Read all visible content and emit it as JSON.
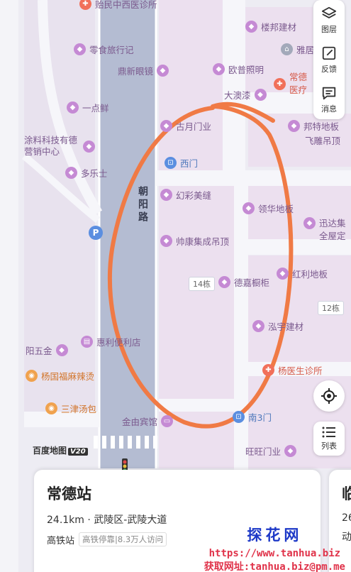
{
  "map": {
    "road_main": "朝阳路",
    "pois": [
      {
        "id": "poi-clinic-top",
        "label": "贻民中西医诊所",
        "icon": "clinic-icon"
      },
      {
        "id": "poi-lingshi",
        "label": "零食旅行记",
        "icon": "shop-icon"
      },
      {
        "id": "poi-dingxin",
        "label": "鼎新眼镜",
        "icon": "shop-icon"
      },
      {
        "id": "poi-yidianxian",
        "label": "一点鲜",
        "icon": "shop-icon"
      },
      {
        "id": "poi-tuliao",
        "label": "涂料科技有德营销中心",
        "icon": "shop-icon"
      },
      {
        "id": "poi-duole",
        "label": "多乐士",
        "icon": "shop-icon"
      },
      {
        "id": "poi-loupan",
        "label": "楼邦建材",
        "icon": "shop-icon"
      },
      {
        "id": "poi-yafu",
        "label": "雅居",
        "icon": "home-icon"
      },
      {
        "id": "poi-oupu",
        "label": "欧普照明",
        "icon": "shop-icon"
      },
      {
        "id": "poi-changde-hosp",
        "label": "常德医疗",
        "icon": "hospital-icon"
      },
      {
        "id": "poi-daaoqi",
        "label": "大澳漆",
        "icon": "shop-icon"
      },
      {
        "id": "poi-guyue",
        "label": "古月门业",
        "icon": "shop-icon"
      },
      {
        "id": "poi-bangte",
        "label": "邦特地板",
        "icon": "shop-icon"
      },
      {
        "id": "poi-feidiao",
        "label": "飞雕吊顶",
        "icon": "shop-icon"
      },
      {
        "id": "poi-ximen",
        "label": "西门",
        "icon": "gate-icon"
      },
      {
        "id": "poi-huancai",
        "label": "幻彩美缝",
        "icon": "shop-icon"
      },
      {
        "id": "poi-linghua",
        "label": "领华地板",
        "icon": "shop-icon"
      },
      {
        "id": "poi-xunda",
        "label": "迅达集全屋定",
        "icon": "shop-icon"
      },
      {
        "id": "poi-shuaikang",
        "label": "帅康集成吊顶",
        "icon": "shop-icon"
      },
      {
        "id": "poi-dexin",
        "label": "德嘉橱柜",
        "icon": "shop-icon"
      },
      {
        "id": "poi-hongli",
        "label": "红利地板",
        "icon": "shop-icon"
      },
      {
        "id": "poi-hongyu",
        "label": "泓宇建材",
        "icon": "shop-icon"
      },
      {
        "id": "poi-hui",
        "label": "惠利便利店",
        "icon": "cart-icon"
      },
      {
        "id": "poi-yangwu",
        "label": "阳五金",
        "icon": "shop-icon"
      },
      {
        "id": "poi-yangguo",
        "label": "杨国福麻辣烫",
        "icon": "food-icon"
      },
      {
        "id": "poi-yangyi",
        "label": "杨医生诊所",
        "icon": "clinic-icon"
      },
      {
        "id": "poi-sanjin",
        "label": "三津汤包",
        "icon": "food-icon"
      },
      {
        "id": "poi-jinyou",
        "label": "金由宾馆",
        "icon": "hotel-icon"
      },
      {
        "id": "poi-nan3",
        "label": "南3门",
        "icon": "gate-icon"
      },
      {
        "id": "poi-wangwang",
        "label": "旺旺门业",
        "icon": "shop-icon"
      }
    ],
    "building_tags": [
      "14栋",
      "12栋"
    ],
    "parking": "P"
  },
  "controls": {
    "layers": "图层",
    "feedback": "反馈",
    "messages": "消息",
    "list": "列表"
  },
  "logo": {
    "text": "百度地图",
    "version": "V20"
  },
  "card": {
    "title": "常德站",
    "distance_line": "24.1km · 武陵区-武陵大道",
    "type": "高铁站",
    "tag": "高铁停靠|8.3万人访问"
  },
  "card2": {
    "title": "临",
    "line1": "26",
    "line2": "动"
  },
  "watermark": {
    "title": "探花网",
    "url": "https://www.tanhua.biz",
    "contact": "获取网址:tanhua.biz@pm.me"
  },
  "colors": {
    "annotation_circle": "#f07a45",
    "road": "#b3bbd1",
    "block": "#e5d9ee",
    "accent": "#1c38c7"
  }
}
